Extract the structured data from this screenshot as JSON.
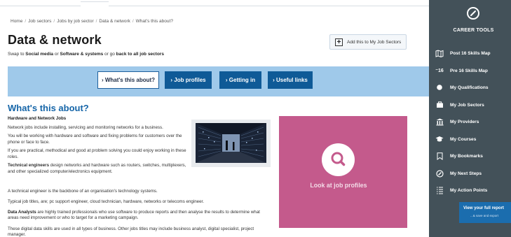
{
  "breadcrumb": [
    "Home",
    "Job sectors",
    "Jobs by job sector",
    "Data & network",
    "What's this about?"
  ],
  "page": {
    "title": "Data & network",
    "swap_prefix": "Swap to ",
    "swap_link_1": "Social media",
    "swap_or": " or ",
    "swap_link_2": "Software & systems",
    "swap_or_go": " or go ",
    "back_link": "back to all job sectors",
    "add_button": "Add this to My Job Sectors"
  },
  "tabs": [
    "› What's this about?",
    "› Job profiles",
    "› Getting in",
    "› Useful links"
  ],
  "section": {
    "title": "What's this about?",
    "heading": "Hardware and Network Jobs",
    "p1": "Network jobs include installing, servicing and monitoring networks for a business.",
    "p2": "You will be working with hardware and software and fixing problems for customers over the phone or face to face.",
    "p3": "If you are practical, methodical and good at problem solving you could enjoy working in these roles.",
    "p4_bold": "Technical engineers",
    "p4_rest": " design networks and hardware such as routers, switches, multiplexers, and other specialized computer/electronics equipment.",
    "p5": "A technical engineer is the backbone of an organisation's technology systems.",
    "p6": "Typical job titles, are; pc support engineer, cloud technician, hardware, networks or telecoms engineer.",
    "p7_bold": "Data Analysts",
    "p7_rest": " are highly trained professionals who use software to produce reports and then analyse the results to determine what areas need improvement or who to target for a marketing campaign.",
    "p8": "These digital data skills are used in all types of business. Other jobs titles may include business analyst, digital specialist, project manager."
  },
  "promo": {
    "label": "Look at job profiles"
  },
  "sidebar": {
    "title": "CAREER TOOLS",
    "items": [
      {
        "label": "Post 16 Skills Map",
        "icon": "map-icon"
      },
      {
        "label": "Pre 16 Skills Map",
        "icon": "pre16-icon",
        "glyph": "⁻16"
      },
      {
        "label": "My Qualifications",
        "icon": "qualification-icon"
      },
      {
        "label": "My Job Sectors",
        "icon": "briefcase-icon"
      },
      {
        "label": "My Providers",
        "icon": "institution-icon"
      },
      {
        "label": "My Courses",
        "icon": "graduation-cap-icon"
      },
      {
        "label": "My Bookmarks",
        "icon": "bookmark-icon"
      },
      {
        "label": "My Next Steps",
        "icon": "compass-icon"
      },
      {
        "label": "My Action Points",
        "icon": "checklist-icon"
      }
    ],
    "report_title": "View your full report",
    "report_sub": "...& save and export"
  },
  "colors": {
    "sidebar_bg": "#435159",
    "tab_bar_bg": "#9fc9ea",
    "tab_dark": "#0f5a97",
    "section_title": "#1565a8",
    "promo_bg": "#c45a8c",
    "report_bg": "#1b6dae"
  }
}
